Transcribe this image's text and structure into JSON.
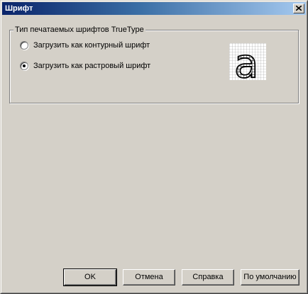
{
  "window": {
    "title": "Шрифт"
  },
  "group": {
    "legend": "Тип печатаемых шрифтов TrueType",
    "options": [
      {
        "label": "Загрузить как контурный шрифт",
        "selected": false
      },
      {
        "label": "Загрузить как растровый шрифт",
        "selected": true
      }
    ],
    "preview": {
      "glyph": "a",
      "icon": "bitmap-font-preview"
    }
  },
  "buttons": {
    "ok": "OK",
    "cancel": "Отмена",
    "help": "Справка",
    "defaults": "По умолчанию"
  }
}
